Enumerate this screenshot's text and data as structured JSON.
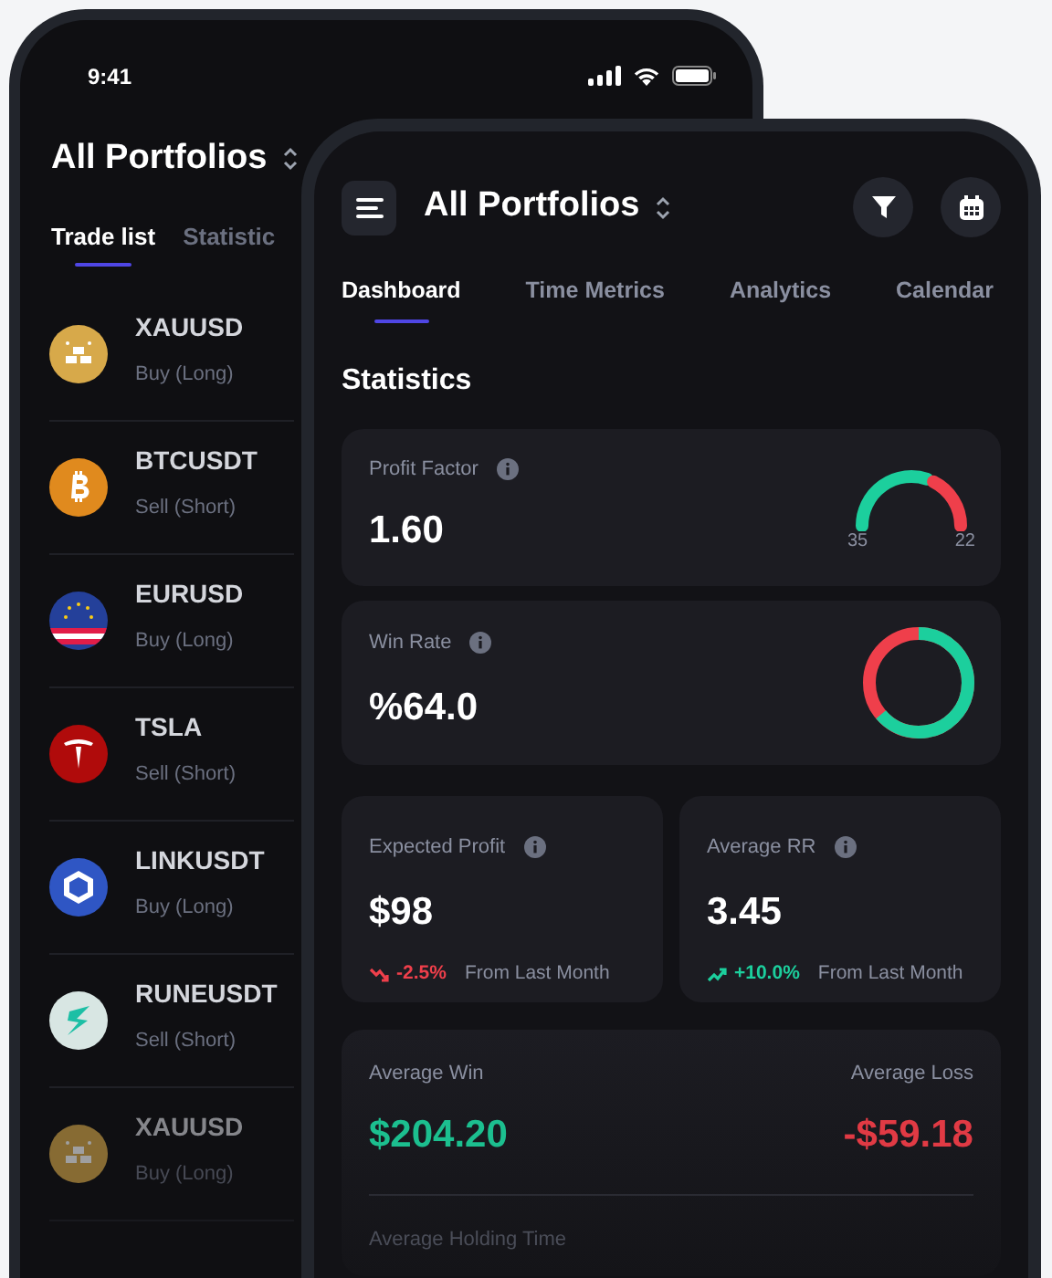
{
  "back_phone": {
    "status_bar": {
      "time": "9:41"
    },
    "title": "All Portfolios",
    "tabs": [
      {
        "label": "Trade list",
        "selected": true
      },
      {
        "label": "Statistic",
        "selected": false
      }
    ],
    "trades": [
      {
        "symbol": "XAUUSD",
        "side": "Buy (Long)",
        "kind": "gold"
      },
      {
        "symbol": "BTCUSDT",
        "side": "Sell (Short)",
        "kind": "coin"
      },
      {
        "symbol": "EURUSD",
        "side": "Buy (Long)",
        "kind": "flag"
      },
      {
        "symbol": "TSLA",
        "side": "Sell (Short)",
        "kind": "t-logo"
      },
      {
        "symbol": "LINKUSDT",
        "side": "Buy (Long)",
        "kind": "hexagon"
      },
      {
        "symbol": "RUNEUSDT",
        "side": "Sell (Short)",
        "kind": "bolt"
      },
      {
        "symbol": "XAUUSD",
        "side": "Buy (Long)",
        "kind": "gold"
      }
    ]
  },
  "front_phone": {
    "title": "All Portfolios",
    "tabs": [
      {
        "label": "Dashboard",
        "selected": true
      },
      {
        "label": "Time Metrics",
        "selected": false
      },
      {
        "label": "Analytics",
        "selected": false
      },
      {
        "label": "Calendar",
        "selected": false
      }
    ],
    "section_title": "Statistics",
    "profit_factor": {
      "label": "Profit Factor",
      "value": "1.60",
      "gauge": {
        "level": 0.62,
        "left_label": "35",
        "right_label": "22"
      }
    },
    "win_rate": {
      "label": "Win Rate",
      "value": "%64.0",
      "donut": {
        "level": 0.64
      }
    },
    "small_cards": [
      {
        "label": "Expected Profit",
        "value": "$98",
        "kind": "down",
        "change": "-2.5%",
        "note": "From Last Month"
      },
      {
        "label": "Average RR",
        "value": "3.45",
        "kind": "up",
        "change": "+10.0%",
        "note": "From Last Month"
      }
    ],
    "averages": {
      "win_label": "Average Win",
      "win_value": "$204.20",
      "loss_label": "Average Loss",
      "loss_value": "-$59.18",
      "holding_label": "Average Holding Time"
    }
  }
}
